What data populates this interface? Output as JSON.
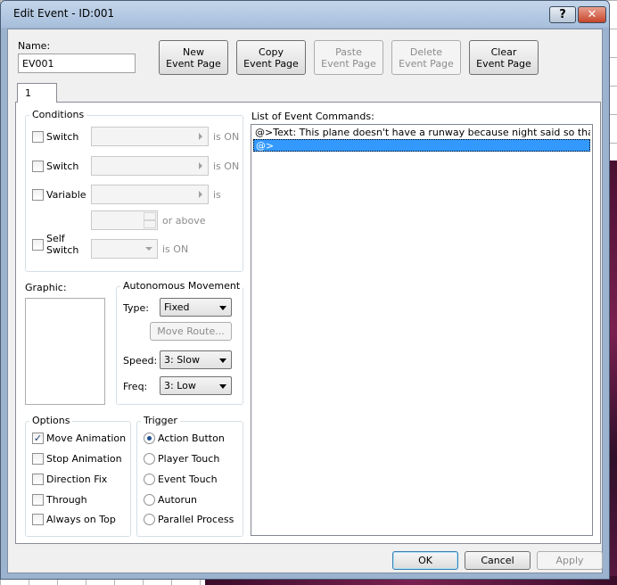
{
  "window": {
    "title": "Edit Event - ID:001",
    "help_label": "?",
    "close_label": "✕"
  },
  "name_section": {
    "label": "Name:",
    "value": "EV001"
  },
  "page_buttons": {
    "new": [
      "New",
      "Event Page"
    ],
    "copy": [
      "Copy",
      "Event Page"
    ],
    "paste": [
      "Paste",
      "Event Page"
    ],
    "delete": [
      "Delete",
      "Event Page"
    ],
    "clear": [
      "Clear",
      "Event Page"
    ]
  },
  "tabs": [
    {
      "label": "1"
    }
  ],
  "conditions": {
    "title": "Conditions",
    "switch1": {
      "label": "Switch",
      "suffix": "is ON"
    },
    "switch2": {
      "label": "Switch",
      "suffix": "is ON"
    },
    "variable": {
      "label": "Variable",
      "suffix": "is",
      "or_above": "or above"
    },
    "self_switch": {
      "label1": "Self",
      "label2": "Switch",
      "suffix": "is ON"
    }
  },
  "graphic": {
    "label": "Graphic:"
  },
  "autonomous": {
    "title": "Autonomous Movement",
    "type_label": "Type:",
    "type_value": "Fixed",
    "move_route_label": "Move Route...",
    "speed_label": "Speed:",
    "speed_value": "3: Slow",
    "freq_label": "Freq:",
    "freq_value": "3: Low"
  },
  "options": {
    "title": "Options",
    "items": [
      {
        "label": "Move Animation",
        "checked": true
      },
      {
        "label": "Stop Animation",
        "checked": false
      },
      {
        "label": "Direction Fix",
        "checked": false
      },
      {
        "label": "Through",
        "checked": false
      },
      {
        "label": "Always on Top",
        "checked": false
      }
    ]
  },
  "trigger": {
    "title": "Trigger",
    "items": [
      {
        "label": "Action Button",
        "selected": true
      },
      {
        "label": "Player Touch",
        "selected": false
      },
      {
        "label": "Event Touch",
        "selected": false
      },
      {
        "label": "Autorun",
        "selected": false
      },
      {
        "label": "Parallel Process",
        "selected": false
      }
    ]
  },
  "commands": {
    "label": "List of Event Commands:",
    "rows": [
      "@>Text: This plane doesn't have a runway because night said so that's why. -",
      "@>"
    ]
  },
  "footer": {
    "ok": "OK",
    "cancel": "Cancel",
    "apply": "Apply"
  }
}
